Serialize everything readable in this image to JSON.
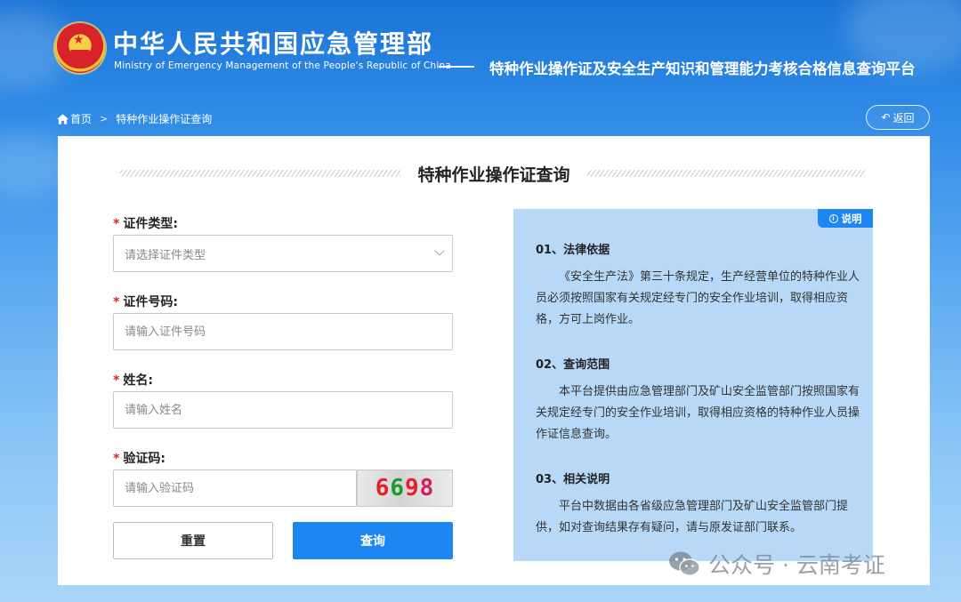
{
  "header": {
    "cn_title": "中华人民共和国应急管理部",
    "en_title": "Ministry of Emergency Management of the People's Republic of China",
    "platform_title": "特种作业操作证及安全生产知识和管理能力考核合格信息查询平台"
  },
  "breadcrumb": {
    "home": "首页",
    "current": "特种作业操作证查询",
    "separator": ">"
  },
  "back_button": {
    "label": "返回"
  },
  "card": {
    "heading": "特种作业操作证查询"
  },
  "form": {
    "required_mark": "*",
    "cert_type": {
      "label": "证件类型:",
      "placeholder": "请选择证件类型"
    },
    "cert_number": {
      "label": "证件号码:",
      "placeholder": "请输入证件号码"
    },
    "name": {
      "label": "姓名:",
      "placeholder": "请输入姓名"
    },
    "captcha": {
      "label": "验证码:",
      "placeholder": "请输入验证码",
      "code": [
        "6",
        "6",
        "9",
        "8"
      ],
      "colors": [
        "#e0232a",
        "#1a9c2a",
        "#e0232a",
        "#d81b60"
      ]
    },
    "reset_label": "重置",
    "query_label": "查询"
  },
  "info": {
    "badge": "说明",
    "sections": [
      {
        "title": "01、法律依据",
        "body": "《安全生产法》第三十条规定，生产经营单位的特种作业人员必须按照国家有关规定经专门的安全作业培训，取得相应资格，方可上岗作业。"
      },
      {
        "title": "02、查询范围",
        "body": "本平台提供由应急管理部门及矿山安全监管部门按照国家有关规定经专门的安全作业培训，取得相应资格的特种作业人员操作证信息查询。"
      },
      {
        "title": "03、相关说明",
        "body": "平台中数据由各省级应急管理部门及矿山安全监管部门提供，如对查询结果存有疑问，请与原发证部门联系。"
      }
    ]
  },
  "watermark": {
    "text": "公众号 · 云南考证"
  },
  "colors": {
    "accent": "#1e86f0",
    "required": "#e0232a",
    "info_bg": "#b7d9f7"
  }
}
